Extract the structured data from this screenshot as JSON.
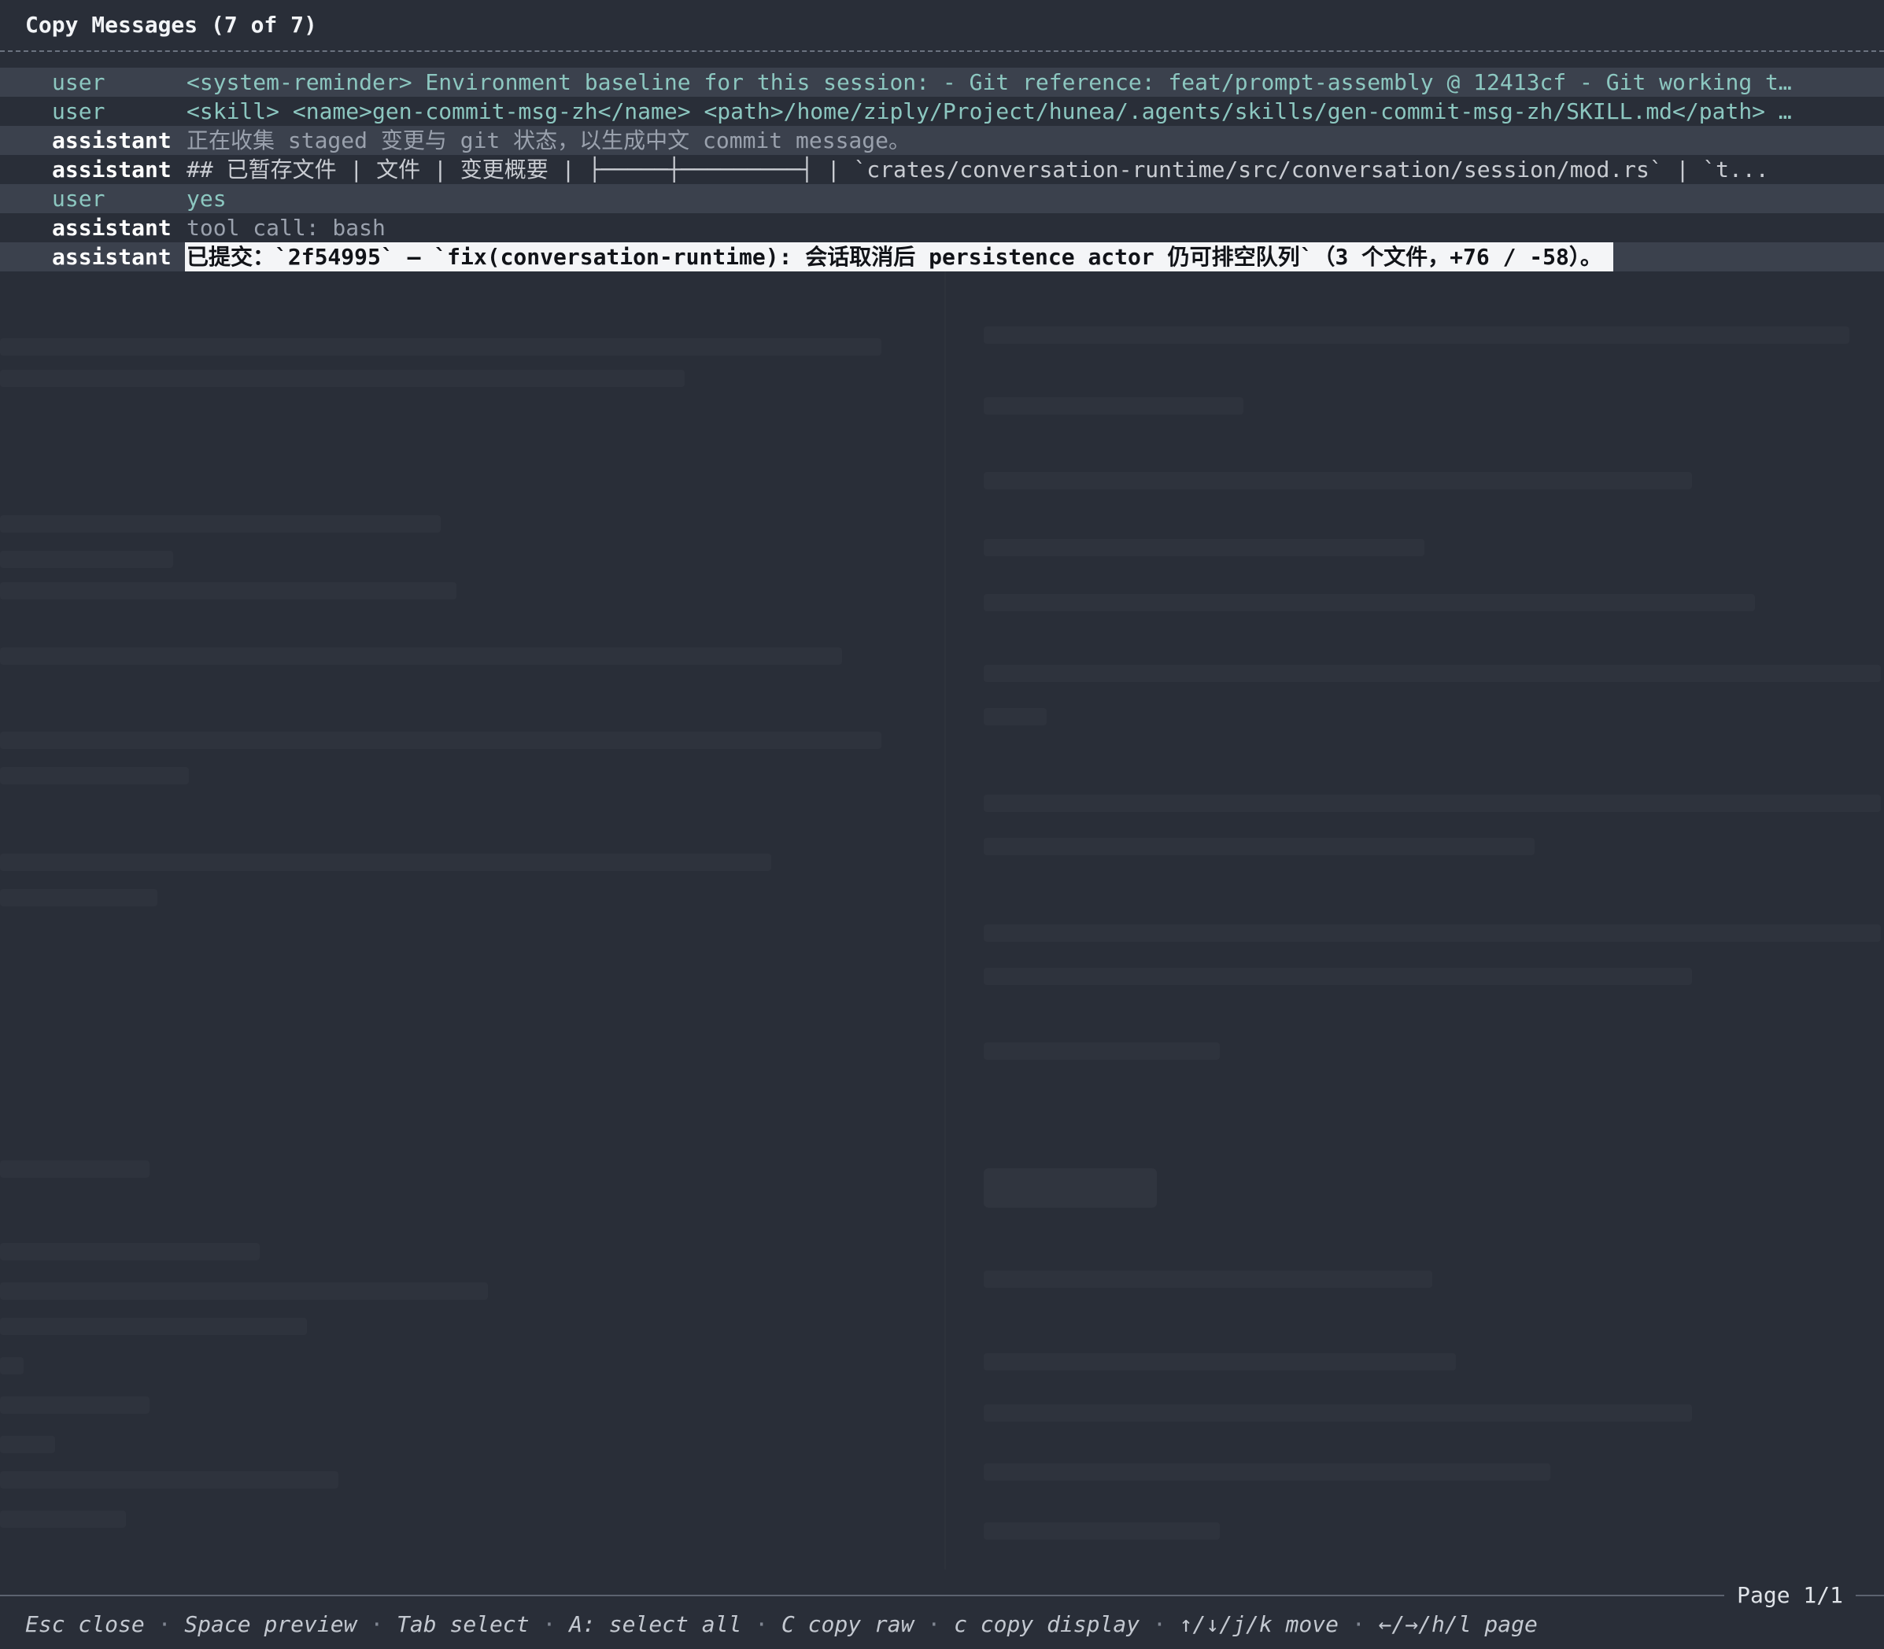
{
  "dialog": {
    "title": "Copy Messages (7 of 7)",
    "page": "Page 1/1"
  },
  "messages": [
    {
      "role": "user",
      "text": "<system-reminder> Environment baseline for this session: - Git reference: feat/prompt-assembly @ 12413cf - Git working t…"
    },
    {
      "role": "user",
      "text": "<skill> <name>gen-commit-msg-zh</name> <path>/home/ziply/Project/hunea/.agents/skills/gen-commit-msg-zh/SKILL.md</path> …"
    },
    {
      "role": "assistant",
      "text": "正在收集 staged 变更与 git 状态，以生成中文 commit message。"
    },
    {
      "role": "assistant",
      "text": "## 已暂存文件 | 文件 | 变更概要 | ├─────┼─────────┤ | `crates/conversation-runtime/src/conversation/session/mod.rs` | `t..."
    },
    {
      "role": "user",
      "text": "yes"
    },
    {
      "role": "assistant",
      "text": "tool call: bash"
    },
    {
      "role": "assistant",
      "text": "已提交：`2f54995` — `fix(conversation-runtime): 会话取消后 persistence actor 仍可排空队列`（3 个文件，+76 / -58）。"
    }
  ],
  "hints": [
    "Esc close",
    "Space preview",
    "Tab select",
    "A: select all",
    "C copy raw",
    "c copy display",
    "↑/↓/j/k move",
    "←/→/h/l page"
  ],
  "separator": "·",
  "colors": {
    "background": "#292e38",
    "row_alt": "#3b414d",
    "user_role": "#8cc7c0",
    "selection_bg": "#f4f5f7"
  }
}
